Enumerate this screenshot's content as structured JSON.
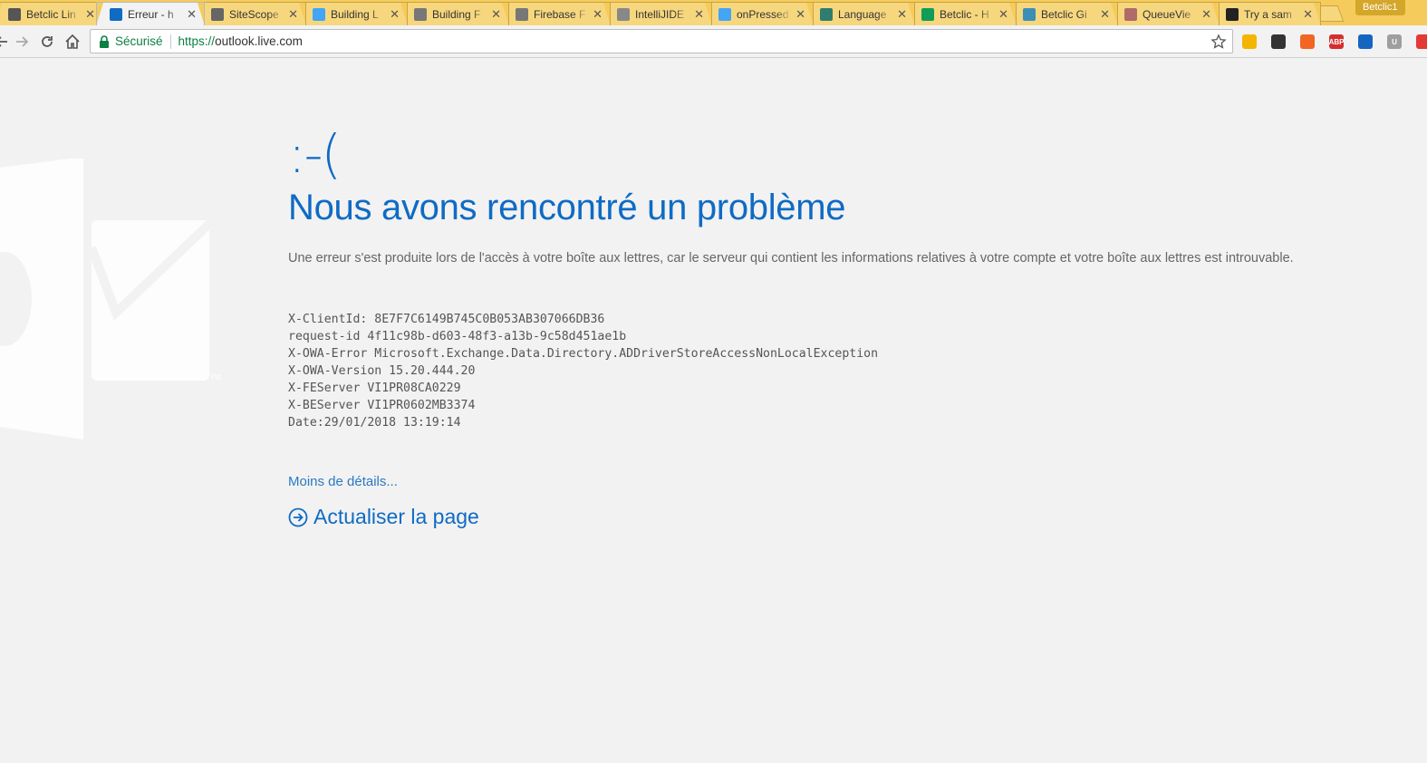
{
  "browser": {
    "tabs": [
      {
        "title": "Betclic Lin",
        "icon": "grid-icon",
        "color": "#555555"
      },
      {
        "title": "Erreur - h",
        "icon": "outlook-icon",
        "color": "#0f6bc4",
        "active": true
      },
      {
        "title": "SiteScope",
        "icon": "monitor-icon",
        "color": "#666666"
      },
      {
        "title": "Building L",
        "icon": "flutter-icon",
        "color": "#42a5f5"
      },
      {
        "title": "Building F",
        "icon": "code-icon",
        "color": "#777777"
      },
      {
        "title": "Firebase F",
        "icon": "code-icon",
        "color": "#777777"
      },
      {
        "title": "IntelliJIDE",
        "icon": "page-icon",
        "color": "#888888"
      },
      {
        "title": "onPressed",
        "icon": "flutter-icon",
        "color": "#42a5f5"
      },
      {
        "title": "Language",
        "icon": "leaf-icon",
        "color": "#2e7d6e"
      },
      {
        "title": "Betclic - H",
        "icon": "sheets-icon",
        "color": "#0f9d58"
      },
      {
        "title": "Betclic Gi",
        "icon": "circle-icon",
        "color": "#3a8fb7"
      },
      {
        "title": "QueueVie",
        "icon": "star-burst-icon",
        "color": "#b06a6a"
      },
      {
        "title": "Try a sam",
        "icon": "m-icon",
        "color": "#222222"
      }
    ],
    "profile_name": "Betclic1",
    "address": {
      "secure_label": "Sécurisé",
      "url_scheme": "https://",
      "url_host": "outlook.live.com"
    },
    "extensions": [
      {
        "name": "chrome-ext-icon",
        "color": "#f4b400"
      },
      {
        "name": "incognito-ext-icon",
        "color": "#333333"
      },
      {
        "name": "x-ext-icon",
        "color": "#f26522"
      },
      {
        "name": "adblock-plus-icon",
        "color": "#d32f2f",
        "label": "ABP"
      },
      {
        "name": "drop-ext-icon",
        "color": "#1565c0"
      },
      {
        "name": "u-ext-icon",
        "color": "#9e9e9e",
        "label": "U"
      },
      {
        "name": "stack-ext-icon",
        "color": "#e53935"
      }
    ]
  },
  "page": {
    "sad_face": ":-(",
    "title": "Nous avons rencontré un problème",
    "description": "Une erreur s'est produite lors de l'accès à votre boîte aux lettres, car le serveur qui contient les informations relatives à votre compte et votre boîte aux lettres est introuvable.",
    "details": [
      "X-ClientId: 8E7F7C6149B745C0B053AB307066DB36",
      "request-id 4f11c98b-d603-48f3-a13b-9c58d451ae1b",
      "X-OWA-Error Microsoft.Exchange.Data.Directory.ADDriverStoreAccessNonLocalException",
      "X-OWA-Version 15.20.444.20",
      "X-FEServer VI1PR08CA0229",
      "X-BEServer VI1PR0602MB3374",
      "Date:29/01/2018 13:19:14"
    ],
    "less_details_label": "Moins de détails...",
    "refresh_label": "Actualiser la page",
    "logo_trademark": "TM"
  },
  "colors": {
    "accent": "#0f6bc4",
    "link": "#2b79c2",
    "background": "#f2f2f2",
    "tabstrip": "#f5cb5c"
  }
}
